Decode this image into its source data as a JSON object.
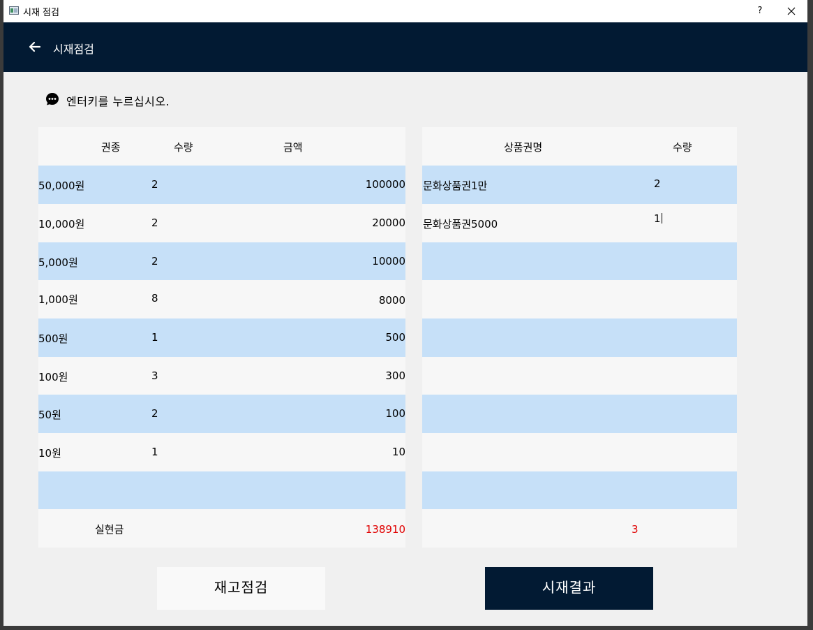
{
  "window": {
    "title": "시재 점검",
    "help": "?",
    "close": "✕"
  },
  "header": {
    "title": "시재점검"
  },
  "notice": {
    "text": "엔터키를 누르십시오."
  },
  "cash_table": {
    "headers": {
      "type": "권종",
      "qty": "수량",
      "amount": "금액"
    },
    "rows": [
      {
        "type": "50,000원",
        "qty": "2",
        "amount": "100000"
      },
      {
        "type": "10,000원",
        "qty": "2",
        "amount": "20000"
      },
      {
        "type": "5,000원",
        "qty": "2",
        "amount": "10000"
      },
      {
        "type": "1,000원",
        "qty": "8",
        "amount": "8000"
      },
      {
        "type": "500원",
        "qty": "1",
        "amount": "500"
      },
      {
        "type": "100원",
        "qty": "3",
        "amount": "300"
      },
      {
        "type": "50원",
        "qty": "2",
        "amount": "100"
      },
      {
        "type": "10원",
        "qty": "1",
        "amount": "10"
      },
      {
        "type": "",
        "qty": "",
        "amount": ""
      }
    ],
    "total_label": "실현금",
    "total_amount": "138910"
  },
  "voucher_table": {
    "headers": {
      "name": "상품권명",
      "qty": "수량"
    },
    "rows": [
      {
        "name": "문화상품권1만",
        "qty": "2"
      },
      {
        "name": "문화상품권5000",
        "qty": "1"
      },
      {
        "name": "",
        "qty": ""
      },
      {
        "name": "",
        "qty": ""
      },
      {
        "name": "",
        "qty": ""
      },
      {
        "name": "",
        "qty": ""
      },
      {
        "name": "",
        "qty": ""
      },
      {
        "name": "",
        "qty": ""
      },
      {
        "name": "",
        "qty": ""
      }
    ],
    "total_qty": "3"
  },
  "buttons": {
    "inventory_check": "재고점검",
    "cash_result": "시재결과"
  },
  "colors": {
    "header_bg": "#021a33",
    "row_blue": "#c6e0f8",
    "row_light": "#f7f7f7",
    "total_red": "#e00000"
  }
}
